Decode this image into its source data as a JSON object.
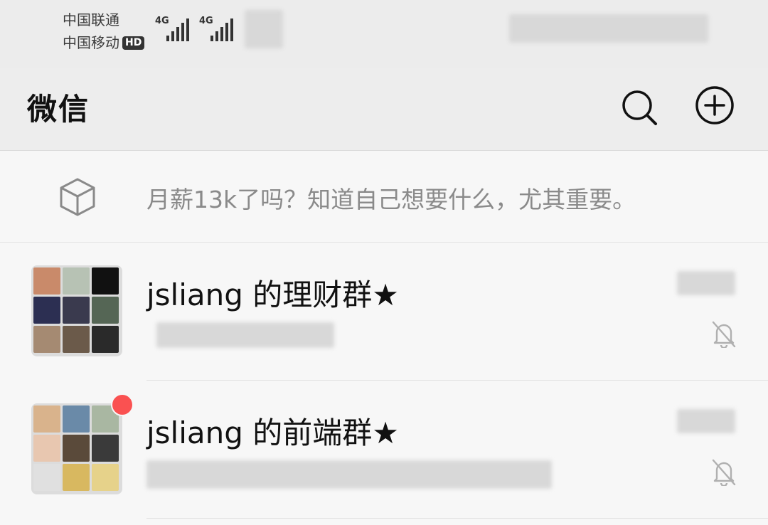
{
  "status_bar": {
    "carrier_1": "中国联通",
    "carrier_2": "中国移动",
    "hd_badge": "HD",
    "signal_1_label": "4G",
    "signal_2_label": "4G"
  },
  "header": {
    "title": "微信",
    "search_icon": "search-icon",
    "add_icon": "add-circle-icon"
  },
  "status_message": {
    "icon": "cube-icon",
    "text": "月薪13k了吗？知道自己想要什么，尤其重要。"
  },
  "chats": [
    {
      "name": "jsliang 的理财群★",
      "muted": true,
      "unread": false
    },
    {
      "name": "jsliang 的前端群★",
      "muted": true,
      "unread": true
    }
  ],
  "colors": {
    "header_bg": "#ededed",
    "list_bg": "#f7f7f7",
    "unread_dot": "#fa5151",
    "status_text": "#8a8a8a"
  }
}
